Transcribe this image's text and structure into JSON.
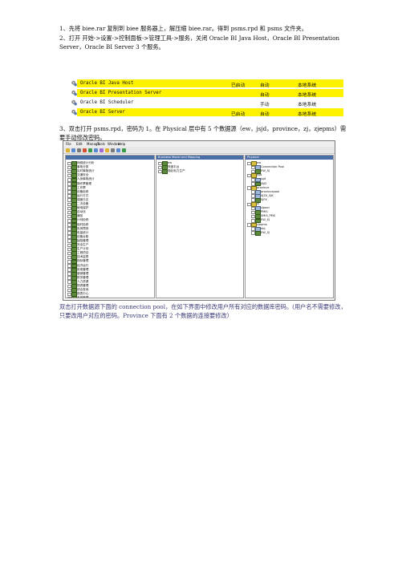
{
  "paragraphs": {
    "p1": "1、先将 biee.rar 复制到 biee 服务器上，解压缩 biee.rar。得到 psms.rpd 和 psms 文件夹。",
    "p2": "2、打开 开始->设置->控制面板->管理工具->服务，关闭 Oracle BI Java Host，Oracle BI Presentation Server，Oracle BI Server 3 个服务。",
    "p3": "3、双击打开 psms.rpd，密码为 1。在 Physical 层中有 5 个数据源（ew，jsjd，province，zj，zjepms）需要手动修改密码。",
    "p4": "双击打开数据源下面的 connection pool，在如下界面中修改用户所有对应的数据库密码。(用户名不需要修改，只要改用户对应的密码。Province 下面有 2 个数据的连接要修改）"
  },
  "services": [
    {
      "name": "Oracle BI Java Host",
      "status": "已启动",
      "startup": "自动",
      "login": "本地系统"
    },
    {
      "name": "Oracle BI Presentation Server",
      "status": "",
      "startup": "自动",
      "login": "本地系统"
    },
    {
      "name": "Oracle BI Scheduler",
      "status": "",
      "startup": "手动",
      "login": "本地系统"
    },
    {
      "name": "Oracle BI Server",
      "status": "已启动",
      "startup": "自动",
      "login": "本地系统"
    }
  ],
  "admin_tool": {
    "menu": [
      "File",
      "Edit",
      "Manage",
      "Tools",
      "Window",
      "Help"
    ],
    "panes": {
      "presentation": {
        "title": "",
        "items": [
          "网络统计分析",
          "事故分类",
          "实时事故统计",
          "交通安全",
          "人身事故统计",
          "操作票管理",
          "工作票",
          "设备检修",
          "运行方式",
          "调度日志",
          "二次设备",
          "继电保护",
          "自动化",
          "通信",
          "计划检修",
          "临时检修",
          "负荷预测",
          "电量统计",
          "设备台账",
          "缺陷管理",
          "安全生产",
          "生产计划",
          "工程项目",
          "技术监督",
          "指标管理",
          "经济运行",
          "用电管理",
          "营销管理",
          "财务管理",
          "人力资源",
          "物资管理",
          "综合查询",
          "报表中心",
          "系统管理",
          "日志"
        ]
      },
      "business": {
        "title": "Business Model and Mapping",
        "items": [
          "ew",
          "快报平台",
          "湖北电力生产"
        ]
      },
      "physical": {
        "title": "Physical",
        "items": [
          {
            "label": "ew",
            "level": 0,
            "kind": "db"
          },
          {
            "label": "Connection Pool",
            "level": 1,
            "kind": "conn"
          },
          {
            "label": "EW_SJ",
            "level": 1,
            "kind": "fld"
          },
          {
            "label": "jsjd",
            "level": 0,
            "kind": "db"
          },
          {
            "label": "jsjd",
            "level": 1,
            "kind": "conn"
          },
          {
            "label": "JSJD",
            "level": 1,
            "kind": "fld"
          },
          {
            "label": "province",
            "level": 0,
            "kind": "db"
          },
          {
            "label": "provincepool",
            "level": 1,
            "kind": "conn"
          },
          {
            "label": "SJZX_SJK",
            "level": 1,
            "kind": "conn"
          },
          {
            "label": "SJFX",
            "level": 1,
            "kind": "fld"
          },
          {
            "label": "zj",
            "level": 0,
            "kind": "db"
          },
          {
            "label": "zjpool",
            "level": 1,
            "kind": "conn"
          },
          {
            "label": "PMIS",
            "level": 1,
            "kind": "fld"
          },
          {
            "label": "SMIS_PMS",
            "level": 1,
            "kind": "fld"
          },
          {
            "label": "EW_SJ",
            "level": 1,
            "kind": "fld"
          },
          {
            "label": "zjepms",
            "level": 0,
            "kind": "db"
          },
          {
            "label": "ebj",
            "level": 1,
            "kind": "conn"
          },
          {
            "label": "EW_SJ",
            "level": 1,
            "kind": "fld"
          }
        ]
      }
    }
  }
}
